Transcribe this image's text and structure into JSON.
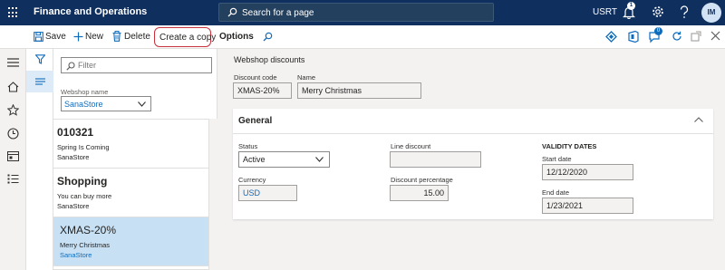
{
  "topbar": {
    "app_title": "Finance and Operations",
    "search_placeholder": "Search for a page",
    "company": "USRT",
    "notification_count": "1",
    "user_initials": "IM"
  },
  "action_pane": {
    "save": "Save",
    "new": "New",
    "delete": "Delete",
    "create_copy": "Create a copy",
    "options": "Options",
    "badge_count": "0"
  },
  "list_pane": {
    "filter_placeholder": "Filter",
    "webshop_label": "Webshop name",
    "webshop_value": "SanaStore",
    "items": [
      {
        "code": "010321",
        "name": "Spring Is Coming",
        "store": "SanaStore"
      },
      {
        "code": "Shopping",
        "name": "You can buy more",
        "store": "SanaStore"
      },
      {
        "code": "XMAS-20%",
        "name": "Merry Christmas",
        "store": "SanaStore",
        "selected": true
      }
    ]
  },
  "details": {
    "header": "Webshop discounts",
    "discount_code_label": "Discount code",
    "discount_code": "XMAS-20%",
    "name_label": "Name",
    "name": "Merry Christmas",
    "general": {
      "title": "General",
      "status_label": "Status",
      "status": "Active",
      "currency_label": "Currency",
      "currency": "USD",
      "line_discount_label": "Line discount",
      "line_discount": "",
      "discount_percentage_label": "Discount percentage",
      "discount_percentage": "15.00",
      "validity_header": "VALIDITY DATES",
      "start_date_label": "Start date",
      "start_date": "12/12/2020",
      "end_date_label": "End date",
      "end_date": "1/23/2021"
    }
  },
  "colors": {
    "topbar": "#0f2f5e",
    "accent": "#0f6cbd",
    "selected_row": "#c7e0f4",
    "highlight_outline": "#c8323c"
  }
}
